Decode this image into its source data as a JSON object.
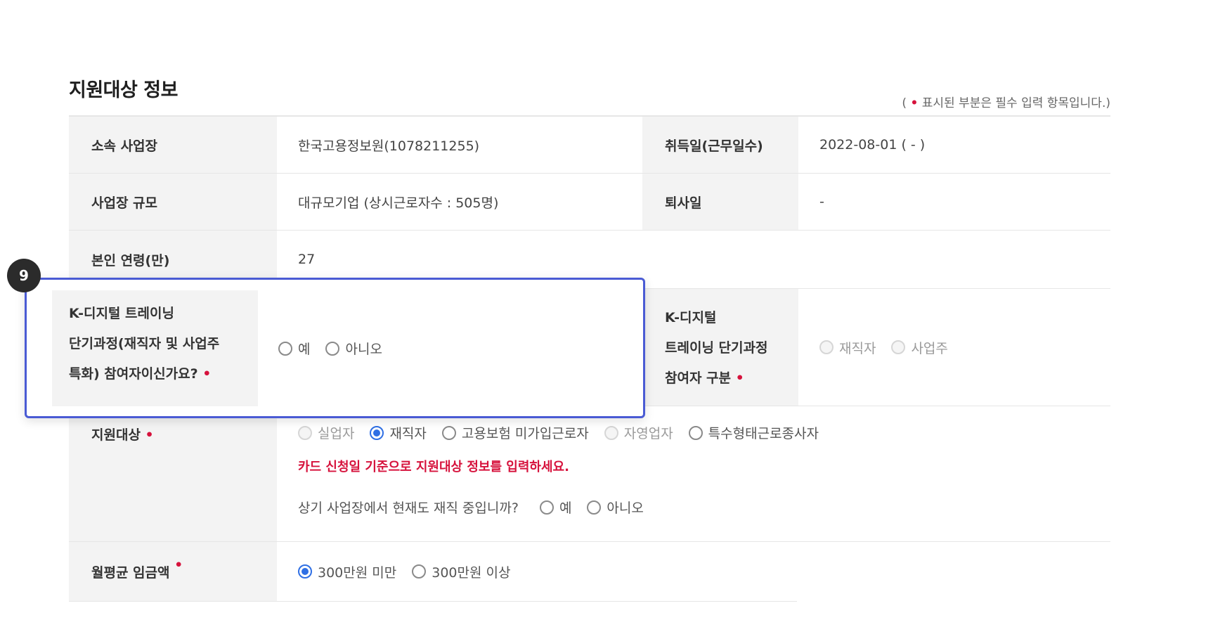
{
  "section": {
    "title": "지원대상 정보",
    "required_note_prefix": "(",
    "required_note_dot": "•",
    "required_note_text": "표시된 부분은 필수 입력 항목입니다.)"
  },
  "rows": {
    "workplace": {
      "label": "소속 사업장",
      "value": "한국고용정보원(1078211255)"
    },
    "acquired": {
      "label": "취득일(근무일수)",
      "value": "2022-08-01 ( - )"
    },
    "scale": {
      "label": "사업장 규모",
      "value": "대규모기업 (상시근로자수 : 505명)"
    },
    "resign": {
      "label": "퇴사일",
      "value": "-"
    },
    "age": {
      "label": "본인 연령(만)",
      "value": "27"
    },
    "kdigital": {
      "label_lines": [
        "K-디지털 트레이닝",
        "단기과정(재직자 및 사업주",
        "특화) 참여자이신가요?"
      ],
      "options": [
        "예",
        "아니오"
      ]
    },
    "kdigital_type": {
      "label_lines": [
        "K-디지털",
        "트레이닝 단기과정",
        "참여자 구분"
      ],
      "options": [
        "재직자",
        "사업주"
      ]
    },
    "support_target": {
      "label": "지원대상",
      "options": [
        "실업자",
        "재직자",
        "고용보험 미가입근로자",
        "자영업자",
        "특수형태근로종사자"
      ],
      "selected": "재직자",
      "warning": "카드 신청일 기준으로 지원대상 정보를 입력하세요.",
      "employed_question": "상기 사업장에서 현재도 재직 중입니까?",
      "employed_options": [
        "예",
        "아니오"
      ]
    },
    "wage": {
      "label": "월평균 임금액",
      "options": [
        "300만원 미만",
        "300만원 이상"
      ],
      "selected": "300만원 미만"
    }
  },
  "badge": {
    "number": "9"
  },
  "colors": {
    "accent": "#2f6fe4",
    "required": "#d6123c",
    "highlight_border": "#4a5bd4"
  }
}
